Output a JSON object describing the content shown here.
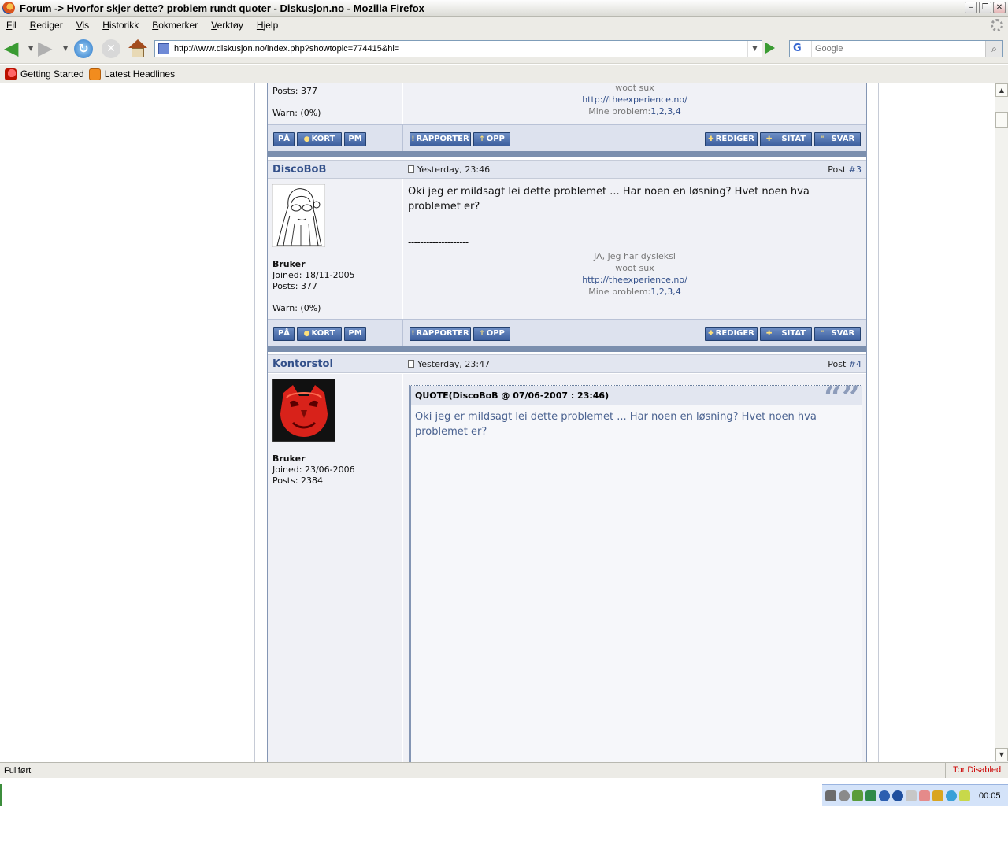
{
  "window": {
    "title": "Forum -> Hvorfor skjer dette? problem rundt quoter - Diskusjon.no - Mozilla Firefox"
  },
  "menu": [
    "Fil",
    "Rediger",
    "Vis",
    "Historikk",
    "Bokmerker",
    "Verktøy",
    "Hjelp"
  ],
  "address": {
    "url": "http://www.diskusjon.no/index.php?showtopic=774415&hl=",
    "search_placeholder": "Google",
    "search_engine": "G"
  },
  "bookmarks": [
    "Getting Started",
    "Latest Headlines"
  ],
  "buttons": {
    "pa": "PÅ",
    "kort": "KORT",
    "pm": "PM",
    "rapporter": "RAPPORTER",
    "opp": "OPP",
    "rediger": "REDIGER",
    "sitat": "SITAT",
    "svar": "SVAR"
  },
  "post_label": "Post",
  "signature": {
    "line": "--------------------",
    "dyslexia": "JA, jeg har dysleksi",
    "woot": "woot sux",
    "link": "http://theexperience.no/",
    "problems_label": "Mine problem:",
    "problems_links": "1,2,3,4"
  },
  "posts": [
    {
      "posts_label": "Posts: 377",
      "warn": "Warn: (0%)"
    },
    {
      "username": "DiscoBoB",
      "date": "Yesterday, 23:46",
      "number": "#3",
      "role": "Bruker",
      "joined": "Joined: 18/11-2005",
      "posts_label": "Posts: 377",
      "warn": "Warn: (0%)",
      "message": "Oki jeg er mildsagt lei dette problemet ... Har noen en løsning? Hvet noen hva problemet er?"
    },
    {
      "username": "Kontorstol",
      "date": "Yesterday, 23:47",
      "number": "#4",
      "role": "Bruker",
      "joined": "Joined: 23/06-2006",
      "posts_label": "Posts: 2384",
      "quote_header": "QUOTE(DiscoBoB @ 07/06-2007 : 23:46)",
      "quote_text": "Oki jeg er mildsagt lei dette problemet ... Har noen en løsning? Hvet noen hva problemet er?"
    }
  ],
  "status": {
    "text": "Fullført",
    "tor": "Tor Disabled",
    "clock": "00:05"
  },
  "colors": {
    "accent": "#33508a",
    "button": "#3d5f9e",
    "tor": "#cc0000"
  }
}
